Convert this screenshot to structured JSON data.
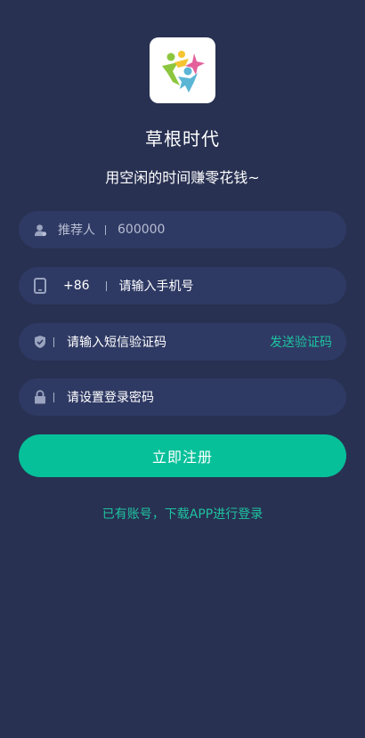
{
  "app": {
    "title": "草根时代",
    "slogan": "用空闲的时间赚零花钱~",
    "logo_icon": "people-star-logo"
  },
  "form": {
    "referrer": {
      "label": "推荐人",
      "value": "600000",
      "icon": "user-icon"
    },
    "phone": {
      "country_code": "+86",
      "placeholder": "请输入手机号",
      "icon": "phone-icon"
    },
    "sms_code": {
      "placeholder": "请输入短信验证码",
      "send_label": "发送验证码",
      "icon": "shield-icon"
    },
    "password": {
      "placeholder": "请设置登录密码",
      "icon": "lock-icon"
    }
  },
  "actions": {
    "register_label": "立即注册",
    "download_link": "已有账号，下载APP进行登录"
  },
  "colors": {
    "background": "#283152",
    "field": "#2f3a64",
    "accent": "#06c09a",
    "link": "#1ec3a0"
  }
}
